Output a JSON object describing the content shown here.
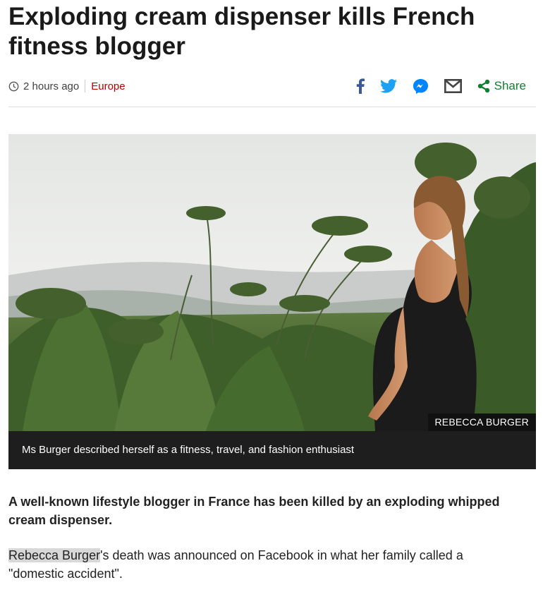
{
  "article": {
    "headline": "Exploding cream dispenser kills French fitness blogger",
    "timestamp": "2 hours ago",
    "section": "Europe",
    "share_label": "Share",
    "share_icons": [
      "facebook-icon",
      "twitter-icon",
      "messenger-icon",
      "email-icon",
      "share-icon"
    ],
    "image_credit": "REBECCA BURGER",
    "image_caption": "Ms Burger described herself as a fitness, travel, and fashion enthusiast",
    "intro": "A well-known lifestyle blogger in France has been killed by an exploding whipped cream dispenser.",
    "body_highlight": "Rebecca Burger",
    "body_rest": "'s death was announced on Facebook in what her family called a \"domestic accident\"."
  },
  "colors": {
    "section_link": "#b80000",
    "facebook": "#3b5998",
    "twitter": "#1da1f2",
    "messenger": "#0084ff",
    "share": "#0f7e2f",
    "caption_bg": "#1e1e1e"
  }
}
